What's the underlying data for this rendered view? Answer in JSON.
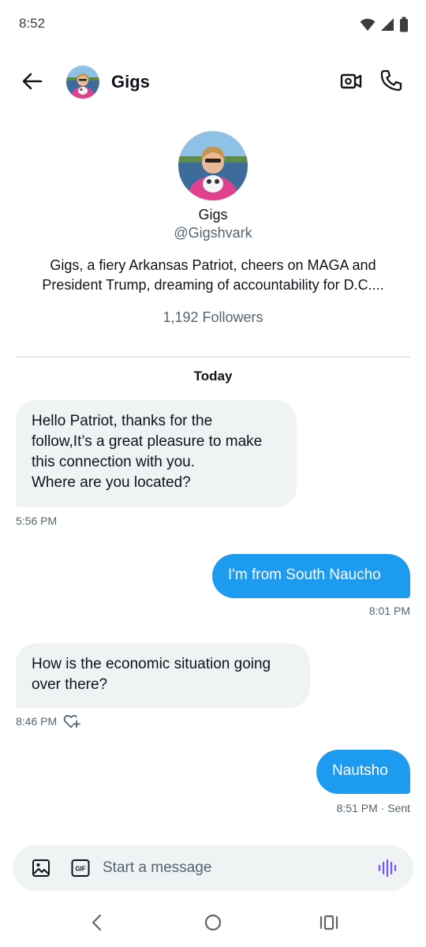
{
  "status_bar": {
    "time": "8:52"
  },
  "header": {
    "name": "Gigs"
  },
  "profile": {
    "name": "Gigs",
    "handle": "@Gigshvark",
    "bio_line1": "Gigs, a fiery Arkansas Patriot, cheers on MAGA and",
    "bio_line2": "President Trump, dreaming of accountability for D.C....",
    "followers": "1,192 Followers"
  },
  "conversation": {
    "date_label": "Today",
    "messages": [
      {
        "direction": "incoming",
        "lines": [
          "Hello Patriot, thanks for the",
          "follow,It’s a great pleasure to make",
          "this connection with you.",
          "Where are you located?"
        ],
        "time": "5:56 PM"
      },
      {
        "direction": "outgoing",
        "lines": [
          "I'm from South Naucho"
        ],
        "time": "8:01 PM"
      },
      {
        "direction": "incoming",
        "lines": [
          "How is the economic situation going",
          "over there?"
        ],
        "time": "8:46 PM"
      },
      {
        "direction": "outgoing",
        "lines": [
          "Nautsho"
        ],
        "time": "8:51 PM · Sent"
      }
    ]
  },
  "composer": {
    "placeholder": "Start a message",
    "gif_label": "GIF"
  },
  "colors": {
    "accent": "#1d9bf0",
    "bubble_in": "#eff3f4",
    "voice": "#7856ff"
  },
  "icons": [
    "wifi-icon",
    "signal-icon",
    "battery-icon",
    "back-arrow-icon",
    "video-camera-icon",
    "phone-icon",
    "image-icon",
    "gif-icon",
    "voice-wave-icon",
    "add-reaction-icon",
    "nav-back-icon",
    "nav-home-icon",
    "nav-recents-icon"
  ]
}
